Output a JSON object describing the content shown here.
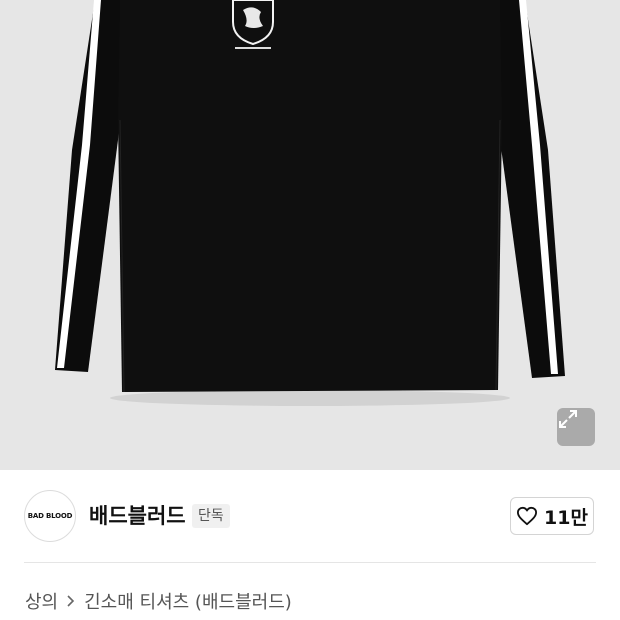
{
  "brand": {
    "logo_text": "BAD BLOOD",
    "name": "배드블러드",
    "badge": "단독"
  },
  "like": {
    "count": "11만",
    "icon": "heart-outline-icon"
  },
  "expand": {
    "icon": "expand-arrows-icon"
  },
  "breadcrumb": {
    "category": "상의",
    "subcategory": "긴소매 티셔츠 (배드블러드)",
    "separator_icon": "chevron-right-icon"
  },
  "colors": {
    "image_background": "#e6e6e6",
    "garment": "#0c0c0c",
    "stripe": "#ffffff",
    "badge_bg": "#f0f0f0"
  }
}
